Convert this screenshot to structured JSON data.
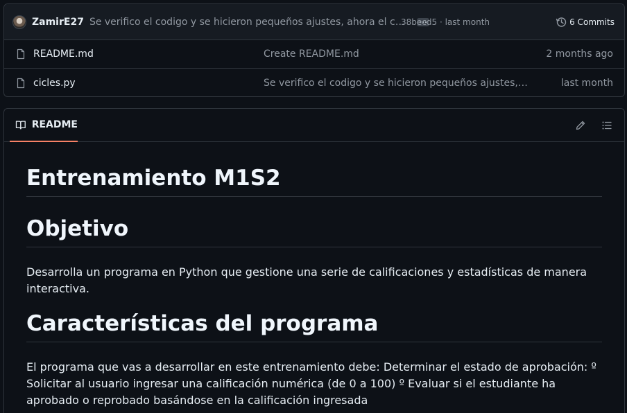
{
  "latest_commit": {
    "author": "ZamirE27",
    "message": "Se verifico el codigo y se hicieron pequeños ajustes, ahora el codigo...",
    "hash": "38becd5",
    "separator": "·",
    "time": "last month",
    "commits_count": "6 Commits"
  },
  "files": [
    {
      "name": "README.md",
      "commit": "Create README.md",
      "date": "2 months ago"
    },
    {
      "name": "cicles.py",
      "commit": "Se verifico el codigo y se hicieron pequeños ajustes, aho...",
      "date": "last month"
    }
  ],
  "readme": {
    "tab_label": "README",
    "title": "Entrenamiento M1S2",
    "section1_heading": "Objetivo",
    "section1_text": "Desarrolla un programa en Python que gestione una serie de calificaciones y estadísticas de manera interactiva.",
    "section2_heading": "Características del programa",
    "section2_text": "El programa que vas a desarrollar en este entrenamiento debe: Determinar el estado de aprobación: º Solicitar al usuario ingresar una calificación numérica (de 0 a 100) º Evaluar si el estudiante ha aprobado o reprobado basándose en la calificación ingresada"
  },
  "colors": {
    "background": "#0d1117",
    "border": "#30363d",
    "accent_tab": "#f78166",
    "muted_text": "#9198a1"
  }
}
